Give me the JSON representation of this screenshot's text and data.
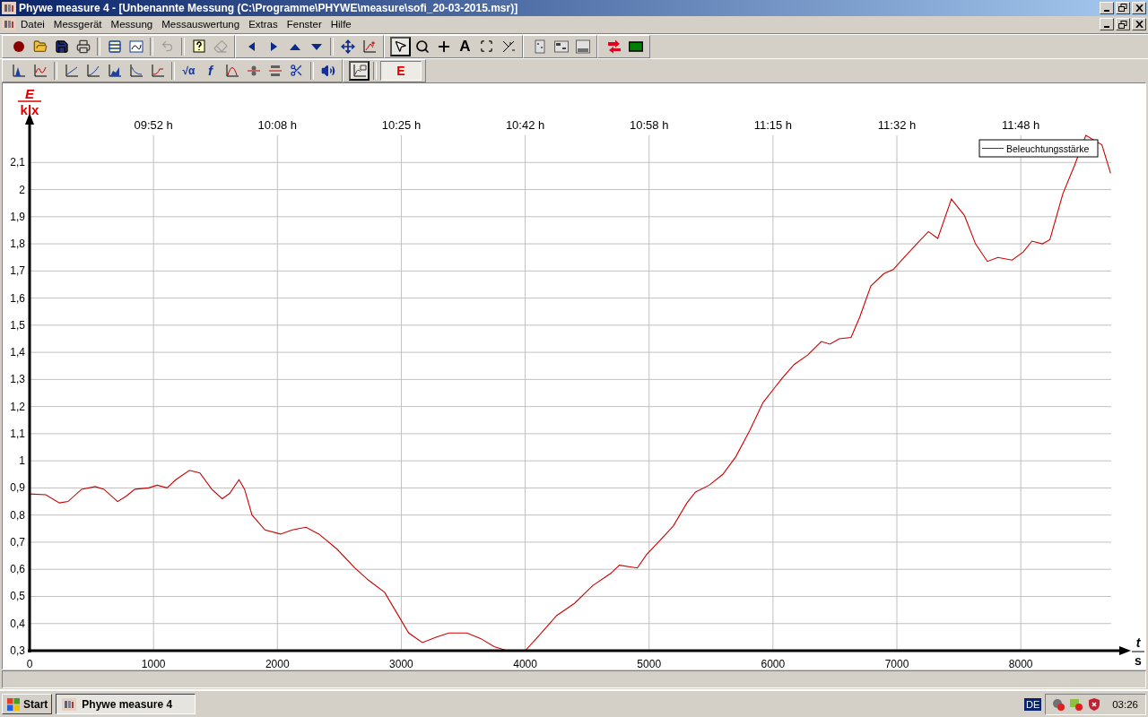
{
  "window": {
    "title": "Phywe measure 4 - [Unbenannte Messung (C:\\Programme\\PHYWE\\measure\\sofi_20-03-2015.msr)]"
  },
  "menu": [
    "Datei",
    "Messgerät",
    "Messung",
    "Messauswertung",
    "Extras",
    "Fenster",
    "Hilfe"
  ],
  "toolbars": {
    "text_tool": "A",
    "root_tool": "√α",
    "function_tool": "f",
    "channel_button": "E"
  },
  "chart": {
    "y_axis": {
      "symbol": "E",
      "unit": "klx"
    },
    "x_axis": {
      "symbol": "t",
      "unit": "s"
    },
    "time_labels": [
      "09:52 h",
      "10:08 h",
      "10:25 h",
      "10:42 h",
      "10:58 h",
      "11:15 h",
      "11:32 h",
      "11:48 h"
    ],
    "chart_data": {
      "type": "line",
      "grid": true,
      "xlim": [
        0,
        8730
      ],
      "ylim": [
        0.3,
        2.2
      ],
      "xticks": [
        0,
        1000,
        2000,
        3000,
        4000,
        5000,
        6000,
        7000,
        8000
      ],
      "yticks": [
        {
          "value": 0.3,
          "label": "0,3"
        },
        {
          "value": 0.4,
          "label": "0,4"
        },
        {
          "value": 0.5,
          "label": "0,5"
        },
        {
          "value": 0.6,
          "label": "0,6"
        },
        {
          "value": 0.7,
          "label": "0,7"
        },
        {
          "value": 0.8,
          "label": "0,8"
        },
        {
          "value": 0.9,
          "label": "0,9"
        },
        {
          "value": 1,
          "label": "1"
        },
        {
          "value": 1.1,
          "label": "1,1"
        },
        {
          "value": 1.2,
          "label": "1,2"
        },
        {
          "value": 1.3,
          "label": "1,3"
        },
        {
          "value": 1.4,
          "label": "1,4"
        },
        {
          "value": 1.5,
          "label": "1,5"
        },
        {
          "value": 1.6,
          "label": "1,6"
        },
        {
          "value": 1.7,
          "label": "1,7"
        },
        {
          "value": 1.8,
          "label": "1,8"
        },
        {
          "value": 1.9,
          "label": "1,9"
        },
        {
          "value": 2,
          "label": "2"
        },
        {
          "value": 2.1,
          "label": "2,1"
        }
      ],
      "x": [
        0,
        130,
        240,
        310,
        420,
        530,
        600,
        710,
        780,
        850,
        960,
        1030,
        1110,
        1180,
        1290,
        1375,
        1470,
        1555,
        1615,
        1690,
        1735,
        1795,
        1900,
        2025,
        2120,
        2230,
        2335,
        2480,
        2625,
        2735,
        2865,
        2950,
        3060,
        3170,
        3280,
        3385,
        3530,
        3640,
        3750,
        3855,
        4000,
        4110,
        4255,
        4400,
        4545,
        4690,
        4760,
        4905,
        4980,
        5085,
        5195,
        5305,
        5375,
        5485,
        5595,
        5700,
        5810,
        5920,
        6005,
        6075,
        6170,
        6280,
        6390,
        6460,
        6535,
        6630,
        6700,
        6790,
        6895,
        6970,
        7040,
        7150,
        7255,
        7330,
        7440,
        7545,
        7635,
        7730,
        7815,
        7930,
        8020,
        8090,
        8175,
        8235,
        8340,
        8435,
        8525,
        8655,
        8725
      ],
      "series": [
        {
          "name": "Beleuchtungsstärke",
          "color": "#cc0000",
          "values": [
            0.878,
            0.875,
            0.845,
            0.85,
            0.895,
            0.905,
            0.895,
            0.85,
            0.87,
            0.895,
            0.9,
            0.91,
            0.9,
            0.93,
            0.965,
            0.955,
            0.895,
            0.86,
            0.88,
            0.93,
            0.895,
            0.8,
            0.745,
            0.73,
            0.745,
            0.755,
            0.73,
            0.675,
            0.605,
            0.56,
            0.515,
            0.45,
            0.365,
            0.33,
            0.35,
            0.365,
            0.365,
            0.345,
            0.315,
            0.3,
            0.3,
            0.355,
            0.43,
            0.475,
            0.54,
            0.585,
            0.615,
            0.605,
            0.655,
            0.705,
            0.76,
            0.845,
            0.885,
            0.91,
            0.95,
            1.015,
            1.11,
            1.215,
            1.265,
            1.305,
            1.355,
            1.39,
            1.44,
            1.43,
            1.45,
            1.455,
            1.53,
            1.645,
            1.69,
            1.705,
            1.74,
            1.795,
            1.845,
            1.82,
            1.965,
            1.905,
            1.8,
            1.735,
            1.75,
            1.74,
            1.77,
            1.81,
            1.8,
            1.815,
            1.985,
            2.09,
            2.2,
            2.165,
            2.06
          ]
        }
      ]
    }
  },
  "taskbar": {
    "start": "Start",
    "task": "Phywe measure 4",
    "language": "DE",
    "clock": "03:26"
  }
}
